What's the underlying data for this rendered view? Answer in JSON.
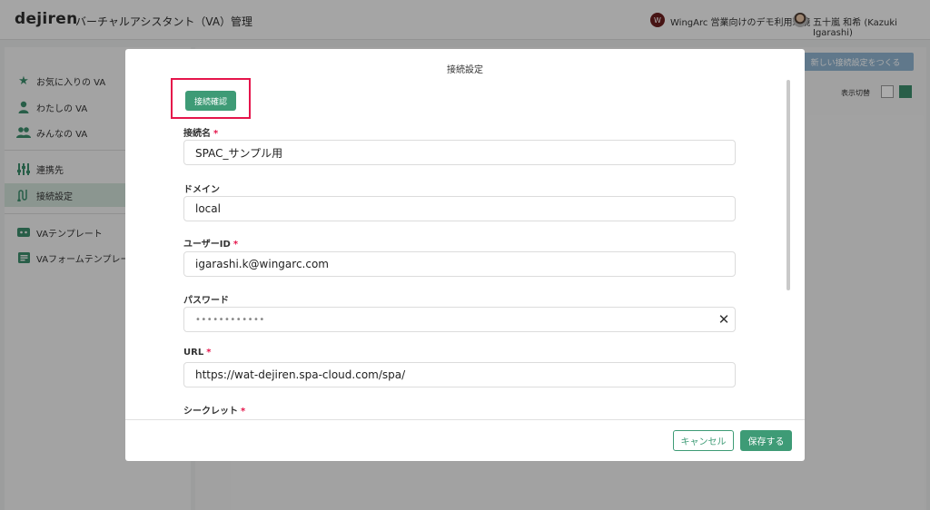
{
  "app": {
    "logo": "dejiren",
    "title": "バーチャルアシスタント（VA）管理",
    "tenant_initial": "W",
    "tenant_name": "WingArc 営業向けのデモ利用環境",
    "user_name": "五十嵐 和希 (Kazuki Igarashi)"
  },
  "sidebar": {
    "items": [
      {
        "label": "お気に入りの VA",
        "icon": "star-icon"
      },
      {
        "label": "わたしの VA",
        "icon": "person-icon"
      },
      {
        "label": "みんなの VA",
        "icon": "people-icon"
      },
      {
        "label": "連携先",
        "icon": "sliders-icon"
      },
      {
        "label": "接続設定",
        "icon": "connection-icon"
      },
      {
        "label": "VAテンプレート",
        "icon": "template-icon"
      },
      {
        "label": "VAフォームテンプレー",
        "icon": "form-template-icon"
      }
    ]
  },
  "main": {
    "new_connection_label": "新しい接続設定をつくる",
    "view_toggle_label": "表示切替"
  },
  "modal": {
    "title": "接続設定",
    "check_button": "接続確認",
    "fields": {
      "connection_name": {
        "label": "接続名",
        "value": "SPAC_サンプル用",
        "required": true
      },
      "domain": {
        "label": "ドメイン",
        "value": "local",
        "required": false
      },
      "user_id": {
        "label": "ユーザーID",
        "value": "igarashi.k@wingarc.com",
        "required": true
      },
      "password": {
        "label": "パスワード",
        "value": "••••••••••••",
        "required": false
      },
      "url": {
        "label": "URL",
        "value": "https://wat-dejiren.spa-cloud.com/spa/",
        "required": true
      },
      "secret": {
        "label": "シークレット",
        "required": true
      }
    },
    "required_mark": "*",
    "clear_glyph": "✕",
    "cancel_button": "キャンセル",
    "save_button": "保存する"
  },
  "colors": {
    "accent": "#3e9b76",
    "highlight": "#e5154b",
    "required": "#e5154b"
  }
}
